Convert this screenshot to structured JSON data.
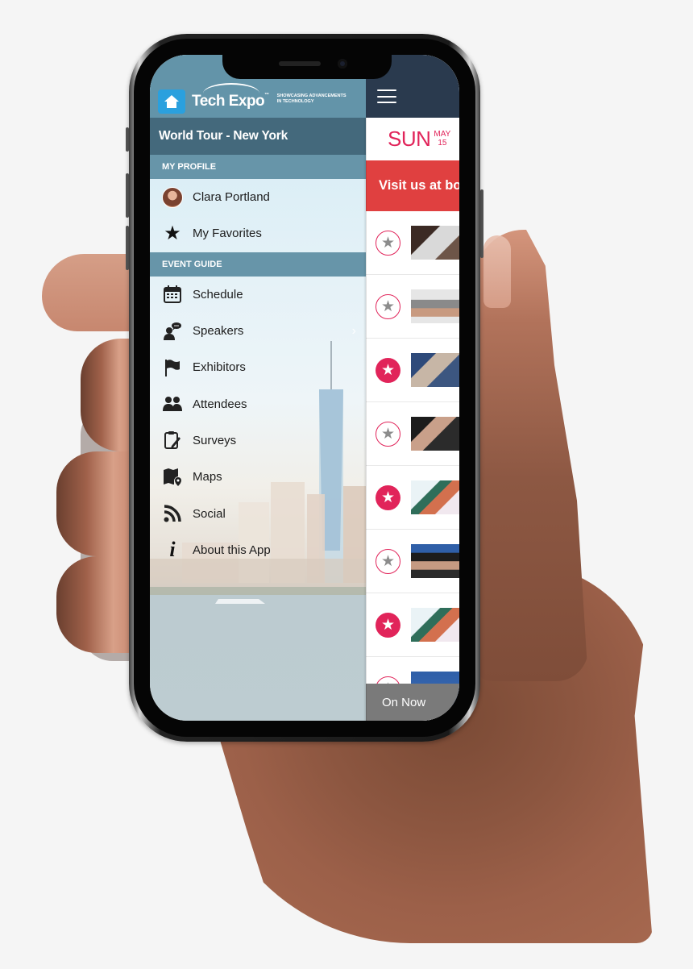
{
  "app": {
    "brand_name": "Tech Expo",
    "brand_tm": "™",
    "brand_tagline_line1": "SHOWCASING ADVANCEMENTS",
    "brand_tagline_line2": "IN TECHNOLOGY",
    "event_title": "World Tour - New York"
  },
  "drawer": {
    "sections": [
      {
        "header": "MY PROFILE",
        "items": [
          {
            "label": "Clara Portland",
            "icon": "avatar"
          },
          {
            "label": "My Favorites",
            "icon": "star-icon"
          }
        ]
      },
      {
        "header": "EVENT GUIDE",
        "items": [
          {
            "label": "Schedule",
            "icon": "calendar-icon"
          },
          {
            "label": "Speakers",
            "icon": "speaker-icon",
            "chevron": "›"
          },
          {
            "label": "Exhibitors",
            "icon": "flag-icon"
          },
          {
            "label": "Attendees",
            "icon": "people-icon"
          },
          {
            "label": "Surveys",
            "icon": "clipboard-icon"
          },
          {
            "label": "Maps",
            "icon": "map-icon"
          },
          {
            "label": "Social",
            "icon": "rss-icon"
          },
          {
            "label": "About this App",
            "icon": "info-icon"
          }
        ]
      }
    ]
  },
  "main": {
    "date": {
      "day_of_week": "SUN",
      "month": "MAY",
      "day": "15"
    },
    "banner": "Visit us at bo",
    "sessions": [
      {
        "favorited": false,
        "thumb": "laptop-meeting"
      },
      {
        "favorited": false,
        "thumb": "laptop-typing"
      },
      {
        "favorited": true,
        "thumb": "tablet-hands"
      },
      {
        "favorited": false,
        "thumb": "laptop-calculator"
      },
      {
        "favorited": true,
        "thumb": "desk-notebook"
      },
      {
        "favorited": false,
        "thumb": "laptop-calculator-blue"
      },
      {
        "favorited": true,
        "thumb": "desk-notebook"
      },
      {
        "favorited": false,
        "thumb": "blue-partial"
      }
    ],
    "on_now": "On Now"
  },
  "colors": {
    "accent_pink": "#e1245a",
    "banner_red": "#e04040",
    "topbar_navy": "#2a3a4e",
    "drawer_brand": "#6394a9",
    "drawer_event": "#44697c",
    "on_now_gray": "#7a7a7a"
  },
  "icons": {
    "star": "★",
    "hamburger": "menu-icon"
  }
}
